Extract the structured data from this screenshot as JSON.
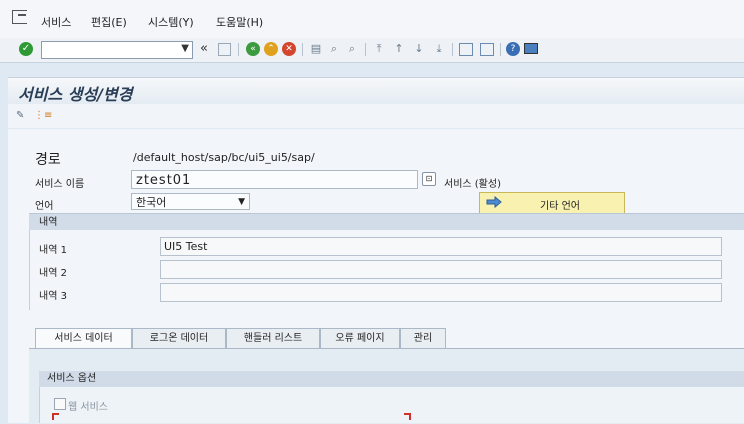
{
  "menubar": {
    "items": [
      "서비스",
      "편집(E)",
      "시스템(Y)",
      "도움말(H)"
    ]
  },
  "toolbar": {
    "command_value": "",
    "back_glyph": "«"
  },
  "title": "서비스 생성/변경",
  "form": {
    "path_label": "경로",
    "path_value": "/default_host/sap/bc/ui5_ui5/sap/",
    "service_name_label": "서비스 이름",
    "service_name_value": "ztest01",
    "service_status": "서비스 (활성)",
    "language_label": "언어",
    "language_value": "한국어",
    "other_language_button": "기타 언어"
  },
  "description": {
    "header": "내역",
    "rows": [
      {
        "label": "내역 1",
        "value": "UI5 Test"
      },
      {
        "label": "내역 2",
        "value": ""
      },
      {
        "label": "내역 3",
        "value": ""
      }
    ]
  },
  "tabs": [
    "서비스 데이터",
    "로그온 데이터",
    "핸들러 리스트",
    "오류 페이지",
    "관리"
  ],
  "service_options": {
    "header": "서비스 옵션",
    "web_service_label": "웹 서비스"
  },
  "colors": {
    "ok_green": "#2f9a35",
    "title_text": "#2a3f57",
    "yellow_button": "#f9f1b0"
  }
}
